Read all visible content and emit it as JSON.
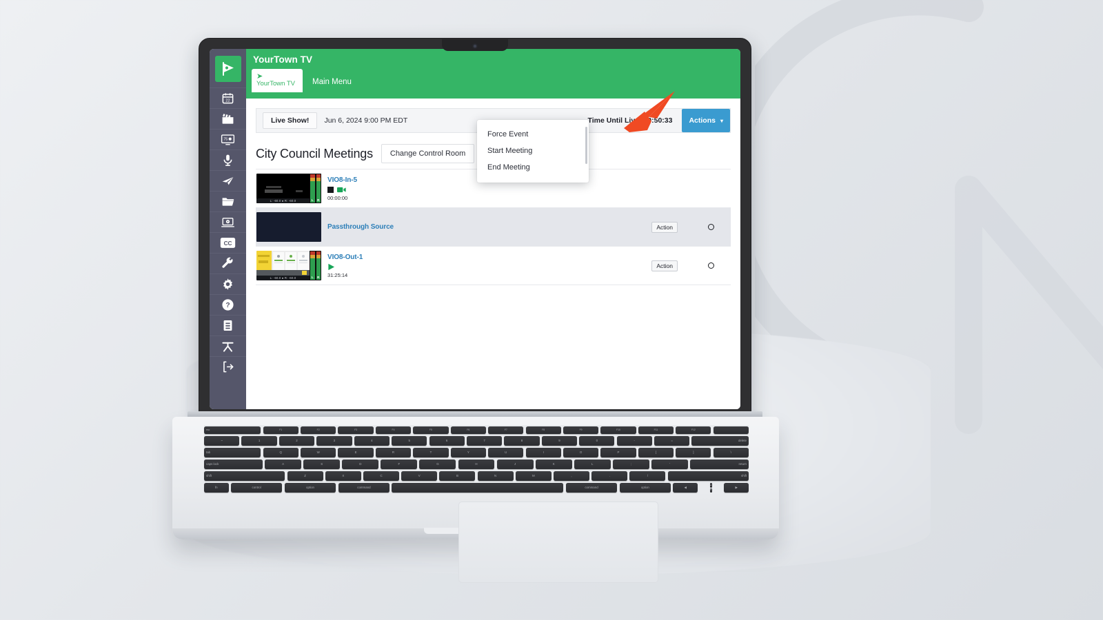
{
  "app": {
    "brand_title": "YourTown TV",
    "logo_icon": "flag-play-icon",
    "tab_brand_label": "YourTown TV",
    "tab_brand_icon": "navigation-arrow-icon",
    "tab_main_label": "Main Menu"
  },
  "colors": {
    "brand_green": "#35b566",
    "accent_blue": "#3a9bd0",
    "sidebar": "#55566a",
    "link_blue": "#2d7fb8",
    "row_highlight": "#e4e6eb",
    "annotation_red": "#f04a23"
  },
  "sidebar": {
    "items": [
      {
        "name": "calendar-icon",
        "label": "Calendar",
        "badge": "22"
      },
      {
        "name": "clapperboard-icon",
        "label": "Productions"
      },
      {
        "name": "monitor-icon",
        "label": "Channel",
        "badge": "75"
      },
      {
        "name": "microphone-icon",
        "label": "Audio"
      },
      {
        "name": "paper-plane-icon",
        "label": "Send"
      },
      {
        "name": "folder-icon",
        "label": "Files"
      },
      {
        "name": "laptop-player-icon",
        "label": "Player"
      },
      {
        "name": "closed-caption-icon",
        "label": "CC"
      },
      {
        "name": "wrench-icon",
        "label": "Tools"
      },
      {
        "name": "gear-icon",
        "label": "Settings"
      },
      {
        "name": "help-icon",
        "label": "Help"
      },
      {
        "name": "document-icon",
        "label": "Logs"
      },
      {
        "name": "accessibility-icon",
        "label": "Accessibility"
      },
      {
        "name": "logout-icon",
        "label": "Log Out"
      }
    ]
  },
  "event_bar": {
    "live_label": "Live Show!",
    "date": "Jun 6, 2024 9:00 PM EDT",
    "time_until_live": "Time Until Live: 00:50:33",
    "actions_label": "Actions",
    "caret_icon": "chevron-down-icon"
  },
  "actions_menu": {
    "open": true,
    "items": [
      {
        "label": "Force Event"
      },
      {
        "label": "Start Meeting"
      },
      {
        "label": "End Meeting"
      }
    ]
  },
  "page": {
    "title": "City Council Meetings",
    "change_control_room_label": "Change Control Room"
  },
  "sources": [
    {
      "name": "VIO8-In-5",
      "thumb_type": "black-video",
      "thumb_db": "L: -60.0  ●  R: -60.0",
      "icons": [
        "stop-square-icon",
        "camcorder-icon"
      ],
      "timecode": "00:00:00",
      "action_label": "",
      "status_icon": "",
      "highlight": false
    },
    {
      "name": "Passthrough Source",
      "thumb_type": "dark-navy",
      "thumb_db": "",
      "icons": [],
      "timecode": "",
      "action_label": "Action",
      "status_icon": "circle-icon",
      "highlight": true
    },
    {
      "name": "VIO8-Out-1",
      "thumb_type": "slide-deck",
      "thumb_db": "L: -60.0  ●  R: -60.0",
      "icons": [
        "play-icon"
      ],
      "timecode": "31:25:14",
      "action_label": "Action",
      "status_icon": "circle-icon",
      "highlight": false
    }
  ],
  "annotation": {
    "arrow_icon": "red-arrow-icon",
    "points_to": "Actions"
  },
  "background": {
    "watermark_icon": "cursor-loading-watermark-icon"
  },
  "keyboard": {
    "fn_row": [
      "esc",
      "F1",
      "F2",
      "F3",
      "F4",
      "F5",
      "F6",
      "F7",
      "F8",
      "F9",
      "F10",
      "F11",
      "F12",
      ""
    ],
    "num_row": [
      "~",
      "1",
      "2",
      "3",
      "4",
      "5",
      "6",
      "7",
      "8",
      "9",
      "0",
      "-",
      "=",
      "delete"
    ],
    "q_row": [
      "tab",
      "Q",
      "W",
      "E",
      "R",
      "T",
      "Y",
      "U",
      "I",
      "O",
      "P",
      "[",
      "]",
      "\\"
    ],
    "a_row": [
      "caps lock",
      "A",
      "S",
      "D",
      "F",
      "G",
      "H",
      "J",
      "K",
      "L",
      ";",
      "'",
      "return"
    ],
    "z_row": [
      "shift",
      "Z",
      "X",
      "C",
      "V",
      "B",
      "N",
      "M",
      ",",
      ".",
      "/",
      "shift"
    ],
    "space_row": [
      "fn",
      "control",
      "option",
      "command",
      "",
      "command",
      "option"
    ]
  }
}
